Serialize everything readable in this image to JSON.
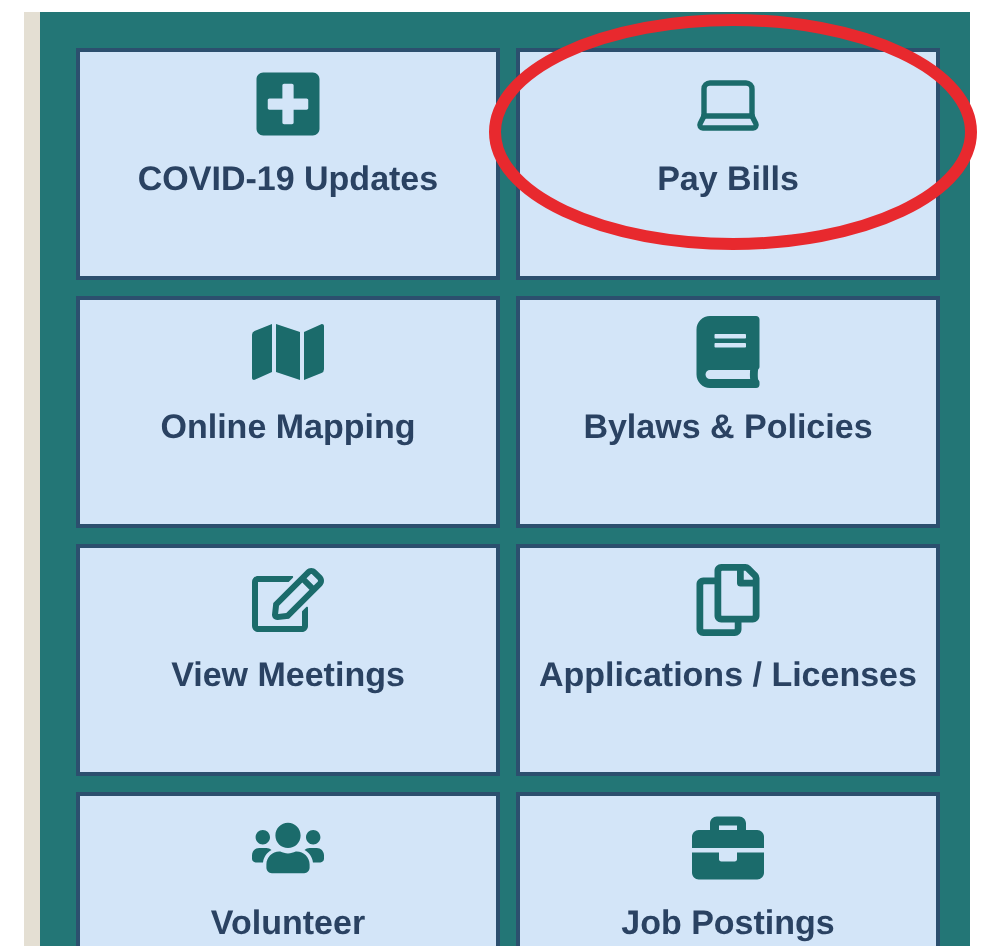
{
  "tiles": [
    {
      "label": "COVID-19 Updates",
      "circled": false
    },
    {
      "label": "Pay Bills",
      "circled": true
    },
    {
      "label": "Online Mapping",
      "circled": false
    },
    {
      "label": "Bylaws & Policies",
      "circled": false
    },
    {
      "label": "View Meetings",
      "circled": false
    },
    {
      "label": "Applications / Licenses",
      "circled": false
    },
    {
      "label": "Volunteer",
      "circled": false
    },
    {
      "label": "Job Postings",
      "circled": false
    }
  ]
}
